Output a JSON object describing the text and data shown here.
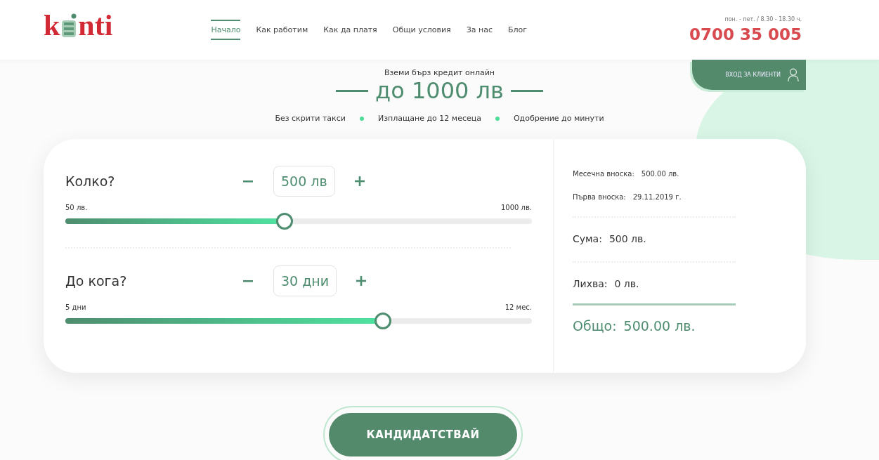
{
  "header": {
    "logo": {
      "start": "k",
      "end": "nti"
    },
    "nav": [
      {
        "label": "Начало",
        "selected": true
      },
      {
        "label": "Как работим",
        "selected": false
      },
      {
        "label": "Как да платя",
        "selected": false
      },
      {
        "label": "Общи условия",
        "selected": false
      },
      {
        "label": "За нас",
        "selected": false
      },
      {
        "label": "Блог",
        "selected": false
      }
    ],
    "hours": "пон. - пет. / 8.30 - 18.30 ч.",
    "phone": "0700 35 005",
    "login": "ВХОД ЗА КЛИЕНТИ"
  },
  "hero": {
    "subtitle": "Вземи бърз кредит онлайн",
    "title": "до 1000 лв",
    "features": [
      "Без скрити такси",
      "Изплащане до 12 месеца",
      "Одобрение до минути"
    ]
  },
  "calculator": {
    "sliders": [
      {
        "label": "Колко?",
        "value": "500 лв",
        "min": "50 лв.",
        "max": "1000 лв.",
        "level": 0.47
      },
      {
        "label": "До кога?",
        "value": "30 дни",
        "min": "5 дни",
        "max": "12 мес.",
        "level": 0.68
      }
    ],
    "summary": {
      "details": [
        {
          "label": "Месечна вноска:",
          "value": "500.00 лв."
        },
        {
          "label": "Първа вноска:",
          "value": "29.11.2019 г."
        }
      ],
      "rows": [
        {
          "label": "Сума:",
          "value": "500 лв."
        },
        {
          "label": "Лихва:",
          "value": "0 лв."
        }
      ],
      "total": {
        "label": "Общо:",
        "value": "500.00 лв."
      }
    }
  },
  "apply_button": "КАНДИДАТСТВАЙ"
}
